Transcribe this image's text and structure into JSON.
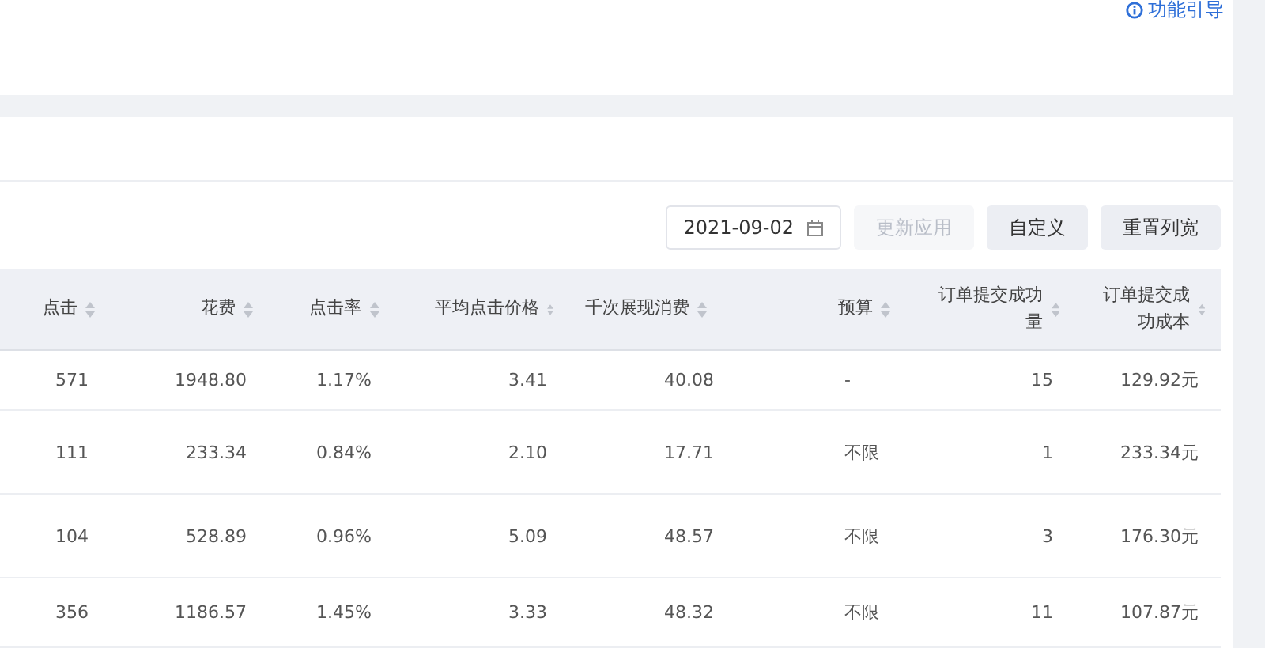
{
  "guide_link": {
    "label": "功能引导"
  },
  "toolbar": {
    "date": "2021-09-02",
    "buttons": [
      {
        "label": "更新应用",
        "disabled": true
      },
      {
        "label": "自定义",
        "disabled": false
      },
      {
        "label": "重置列宽",
        "disabled": false
      }
    ]
  },
  "table": {
    "columns": [
      {
        "label": "点击"
      },
      {
        "label": "花费"
      },
      {
        "label": "点击率"
      },
      {
        "label": "平均点击价格"
      },
      {
        "label": "千次展现消费"
      },
      {
        "label": "预算"
      },
      {
        "label": "订单提交成功量"
      },
      {
        "label": "订单提交成功成本"
      }
    ],
    "rows": [
      {
        "cells": [
          "571",
          "1948.80",
          "1.17%",
          "3.41",
          "40.08",
          "-",
          "15",
          "129.92元"
        ]
      },
      {
        "cells": [
          "111",
          "233.34",
          "0.84%",
          "2.10",
          "17.71",
          "不限",
          "1",
          "233.34元"
        ]
      },
      {
        "cells": [
          "104",
          "528.89",
          "0.96%",
          "5.09",
          "48.57",
          "不限",
          "3",
          "176.30元"
        ]
      },
      {
        "cells": [
          "356",
          "1186.57",
          "1.45%",
          "3.33",
          "48.32",
          "不限",
          "11",
          "107.87元"
        ]
      }
    ]
  }
}
